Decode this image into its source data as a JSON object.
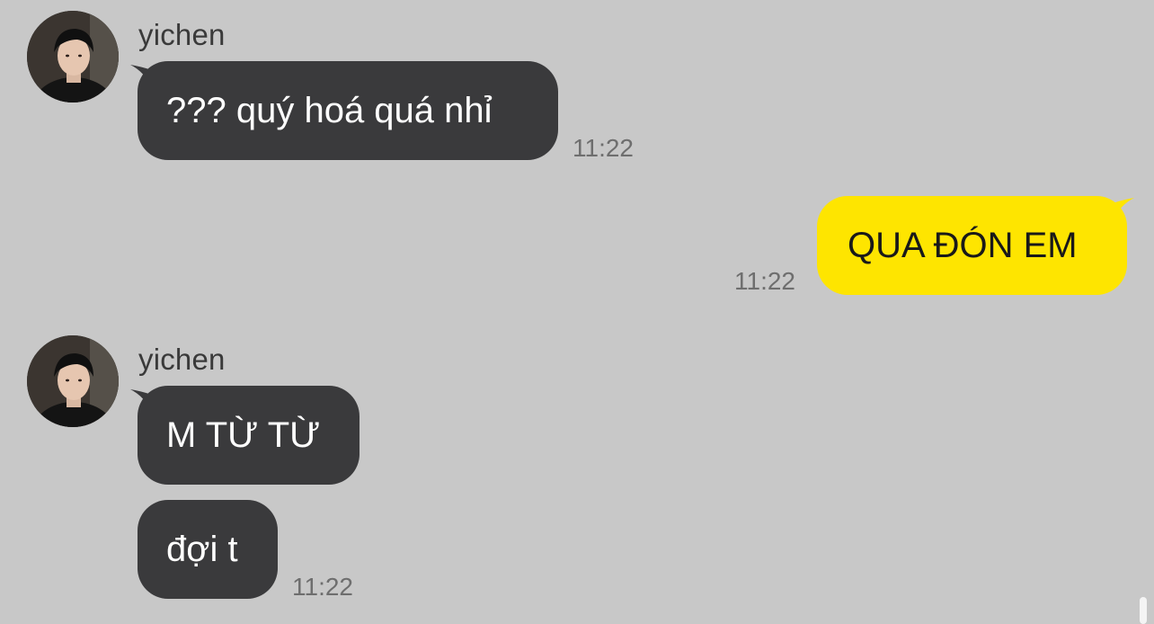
{
  "messages": [
    {
      "sender": "yichen",
      "avatar_icon": "profile-photo",
      "text": "??? quý hoá quá nhỉ",
      "time": "11:22"
    },
    {
      "text": "QUA ĐÓN EM",
      "time": "11:22"
    },
    {
      "sender": "yichen",
      "avatar_icon": "profile-photo",
      "text": "M TỪ TỪ"
    },
    {
      "text": "đợi t",
      "time": "11:22"
    }
  ],
  "colors": {
    "background": "#c8c8c8",
    "incoming_bubble": "#3a3a3c",
    "outgoing_bubble": "#fee500",
    "incoming_text": "#ffffff",
    "outgoing_text": "#191919",
    "timestamp": "#6e6e6e"
  }
}
